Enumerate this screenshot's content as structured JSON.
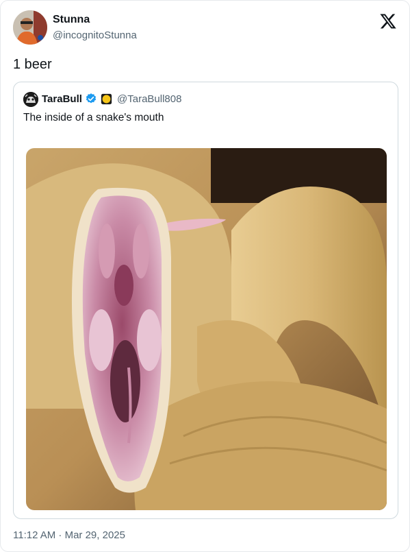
{
  "author": {
    "name": "Stunna",
    "handle": "@incognitoStunna"
  },
  "tweet": {
    "text": "1 beer",
    "timestamp": "11:12 AM · Mar 29, 2025"
  },
  "quoted_tweet": {
    "name": "TaraBull",
    "handle": "@TaraBull808",
    "text": "The inside of a snake's mouth",
    "verified_color": "#1d9bf0"
  },
  "icons": {
    "x_logo": "x-logo-icon",
    "verified": "verified-badge-icon",
    "emoji": "yellow-circle-emoji-icon"
  },
  "colors": {
    "text": "#0f1419",
    "secondary": "#536471",
    "border": "#cfd9de"
  }
}
